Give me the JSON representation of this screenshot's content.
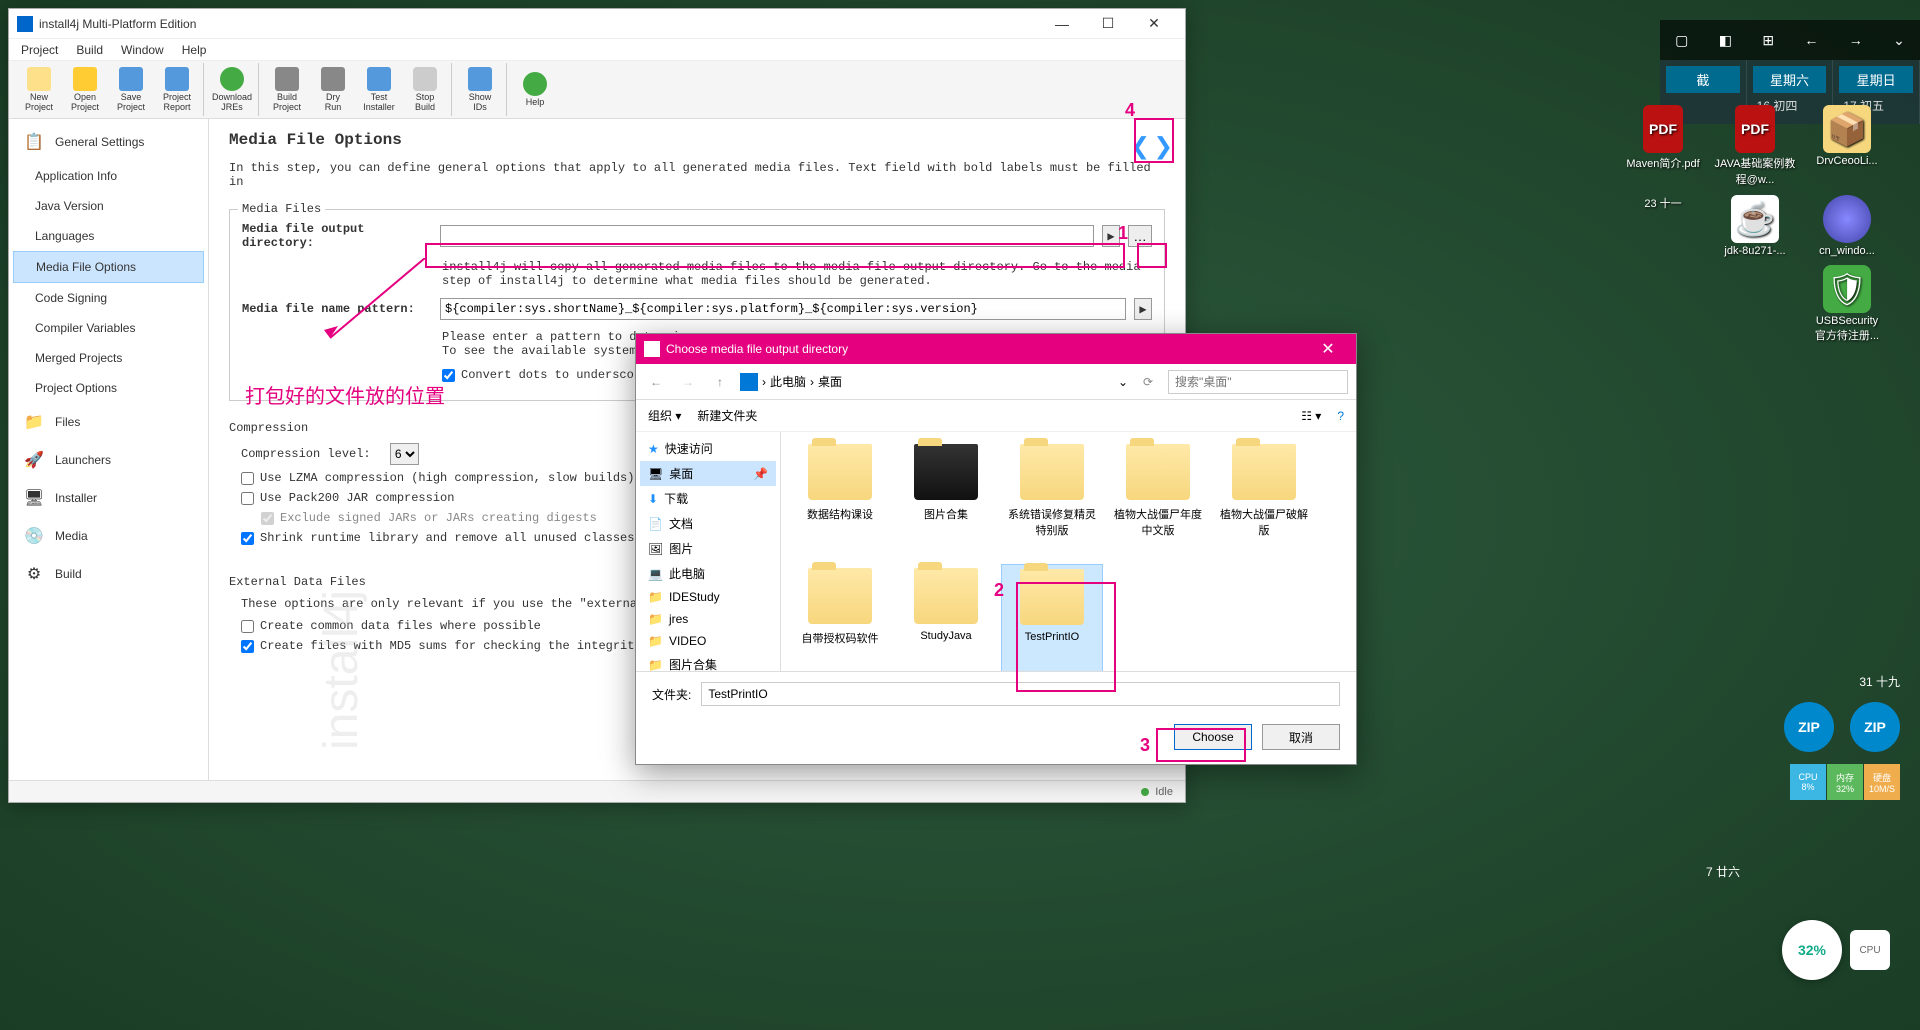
{
  "window": {
    "title": "install4j Multi-Platform Edition",
    "menus": [
      "Project",
      "Build",
      "Window",
      "Help"
    ],
    "toolbar": [
      {
        "label": "New\nProject",
        "color": "#ffcc00"
      },
      {
        "label": "Open\nProject",
        "color": "#ffcc00"
      },
      {
        "label": "Save\nProject",
        "color": "#5599dd"
      },
      {
        "label": "Project\nReport",
        "color": "#5599dd"
      },
      {
        "label": "Download\nJREs",
        "color": "#44aa44"
      },
      {
        "label": "Build\nProject",
        "color": "#888"
      },
      {
        "label": "Dry\nRun",
        "color": "#888"
      },
      {
        "label": "Test\nInstaller",
        "color": "#5599dd"
      },
      {
        "label": "Stop\nBuild",
        "color": "#aaa"
      },
      {
        "label": "Show\nIDs",
        "color": "#5599dd"
      },
      {
        "label": "Help",
        "color": "#44aa44"
      }
    ],
    "status": "Idle"
  },
  "sidebar": {
    "general": "General Settings",
    "items": [
      "Application Info",
      "Java Version",
      "Languages",
      "Media File Options",
      "Code Signing",
      "Compiler Variables",
      "Merged Projects",
      "Project Options"
    ],
    "sections": [
      "Files",
      "Launchers",
      "Installer",
      "Media",
      "Build"
    ]
  },
  "content": {
    "title": "Media File Options",
    "desc": "In this step, you can define general options that apply to all generated media files. Text field with bold labels must be filled in",
    "media_files_legend": "Media Files",
    "output_dir_label": "Media file output directory:",
    "output_dir_value": "",
    "output_dir_help": "install4j will copy all generated media files to the media file output directory. Go to the media step of install4j to determine what media files should be generated.",
    "name_pattern_label": "Media file name pattern:",
    "name_pattern_value": "${compiler:sys.shortName}_${compiler:sys.platform}_${compiler:sys.version}",
    "name_pattern_help": "Please enter a pattern to determine\nTo see the available system variable",
    "convert_dots": "Convert dots to underscores",
    "compression_legend": "Compression",
    "compression_level_label": "Compression level:",
    "compression_level_value": "6",
    "lzma": "Use LZMA compression (high compression, slow builds)",
    "pack200": "Use Pack200 JAR compression",
    "exclude_signed": "Exclude signed JARs or JARs creating digests",
    "shrink": "Shrink runtime library and remove all unused classes",
    "external_legend": "External Data Files",
    "external_desc": "These options are only relevant if you use the \"external\" or \"downloa",
    "common_data": "Create common data files where possible",
    "md5": "Create files with MD5 sums for checking the integrity of data file"
  },
  "annotations": {
    "text1": "打包好的文件放的位置",
    "n1": "1",
    "n2": "2",
    "n3": "3",
    "n4": "4"
  },
  "dialog": {
    "title": "Choose media file output directory",
    "breadcrumb": [
      "此电脑",
      "桌面"
    ],
    "search_placeholder": "搜索\"桌面\"",
    "organize": "组织 ▾",
    "new_folder": "新建文件夹",
    "sidebar": [
      {
        "label": "快速访问",
        "icon": "★",
        "color": "#1e90ff"
      },
      {
        "label": "桌面",
        "icon": "🖥",
        "sel": true
      },
      {
        "label": "下载",
        "icon": "⬇",
        "color": "#1e90ff"
      },
      {
        "label": "文档",
        "icon": "📄"
      },
      {
        "label": "图片",
        "icon": "🖼"
      },
      {
        "label": "此电脑",
        "icon": "💻"
      },
      {
        "label": "IDEStudy",
        "icon": "📁",
        "color": "#f7d77e"
      },
      {
        "label": "jres",
        "icon": "📁",
        "color": "#f7d77e"
      },
      {
        "label": "VIDEO",
        "icon": "📁",
        "color": "#f7d77e"
      },
      {
        "label": "图片合集",
        "icon": "📁",
        "color": "#f7d77e"
      }
    ],
    "files_row1": [
      "数据结构课设",
      "图片合集",
      "系统错误修复精灵特别版",
      "植物大战僵尸年度中文版",
      "植物大战僵尸破解版"
    ],
    "files_row2": [
      "自带授权码软件",
      "StudyJava",
      "TestPrintIO"
    ],
    "folder_label": "文件夹:",
    "folder_value": "TestPrintIO",
    "choose": "Choose",
    "cancel": "取消"
  },
  "desktop": {
    "taskbar_icons": [
      "▢",
      "◧",
      "⊞",
      "←",
      "→",
      "⌄"
    ],
    "cal": [
      {
        "header": "截",
        "date": ""
      },
      {
        "header": "星期六",
        "date": "16 初四"
      },
      {
        "header": "星期日",
        "date": "17 初五"
      }
    ],
    "icons": [
      {
        "label": "Maven简介.pdf",
        "type": "pdf"
      },
      {
        "label": "JAVA基础案例教程@w...",
        "type": "pdf"
      },
      {
        "label": "DrvCeooLi...",
        "type": "exe"
      },
      {
        "label": "23 十一",
        "type": "text"
      },
      {
        "label": "jdk-8u271-...",
        "type": "java"
      },
      {
        "label": "cn_windo...",
        "type": "disc"
      },
      {
        "label": "",
        "type": ""
      },
      {
        "label": "",
        "type": ""
      },
      {
        "label": "USBSecurity\n官方待注册...",
        "type": "shield"
      },
      {
        "label": "31 十九",
        "type": "text"
      }
    ],
    "perf": [
      {
        "label": "CPU",
        "val": "8%",
        "color": "#3cb6e3"
      },
      {
        "label": "内存",
        "val": "32%",
        "color": "#5cb85c"
      },
      {
        "label": "硬盘",
        "val": "10M/S",
        "color": "#f0ad4e"
      }
    ],
    "cpu_circle": "32%",
    "date_bottom": "7 廿六"
  }
}
